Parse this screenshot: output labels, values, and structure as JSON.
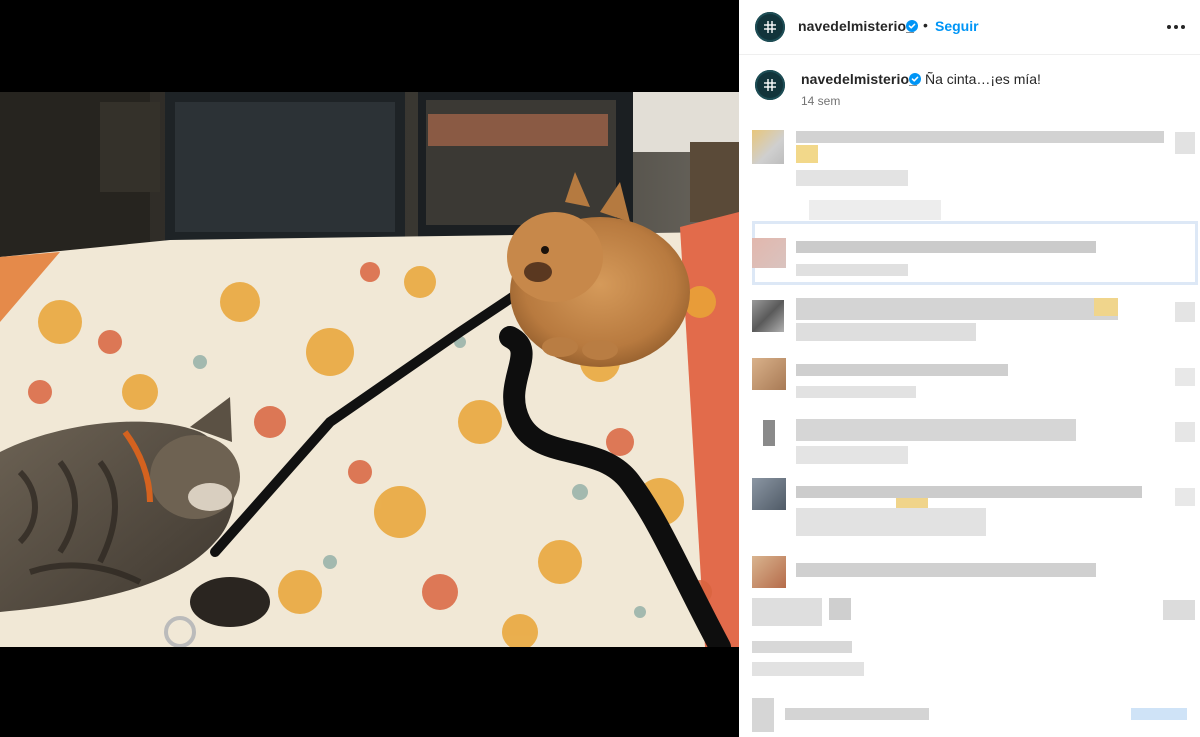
{
  "post": {
    "username": "navedelmisterio_",
    "follow_label": "Seguir",
    "separator": "•",
    "caption": "Ña cinta…¡es mía!",
    "time_ago": "14 sem"
  },
  "icons": {
    "avatar": "hash-logo-icon",
    "verified": "verified-badge-icon",
    "more": "more-options-icon"
  },
  "colors": {
    "follow": "#0095f6",
    "verified": "#0095f6",
    "text": "#262626",
    "secondary": "#737373",
    "media_background": "#000000"
  }
}
